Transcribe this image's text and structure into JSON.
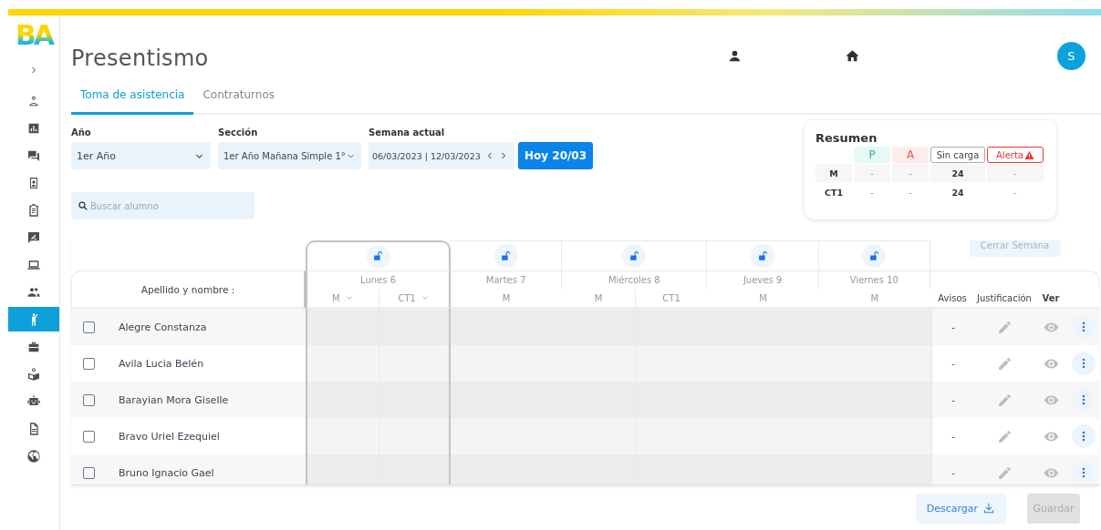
{
  "logo": {
    "text": "BA"
  },
  "sidebar": {
    "items": [
      {
        "selected": false
      },
      {
        "selected": false
      },
      {
        "selected": false
      },
      {
        "selected": false
      },
      {
        "selected": false
      },
      {
        "selected": false
      },
      {
        "selected": false
      },
      {
        "selected": false
      },
      {
        "selected": true
      },
      {
        "selected": false
      },
      {
        "selected": false
      },
      {
        "selected": false
      },
      {
        "selected": false
      },
      {
        "selected": false
      }
    ]
  },
  "header": {
    "title": "Presentismo",
    "avatar": "S"
  },
  "tabs": [
    {
      "label": "Toma de asistencia",
      "selected": true
    },
    {
      "label": "Contraturnos",
      "selected": false
    }
  ],
  "filters": [
    {
      "label": "Año",
      "value": "1er Año",
      "kind": "select"
    },
    {
      "label": "Sección",
      "value": "1er Año Mañana Simple 1°",
      "kind": "select"
    },
    {
      "label": "Semana actual",
      "value": "06/03/2023 | 12/03/2023",
      "kind": "week"
    }
  ],
  "today_button": "Hoy 20/03",
  "search": {
    "placeholder": "Buscar alumno"
  },
  "summary": {
    "title": "Resumen",
    "columns": [
      {
        "label": "P",
        "kind": "present"
      },
      {
        "label": "A",
        "kind": "absent"
      },
      {
        "label": "Sin carga",
        "kind": "empty"
      },
      {
        "label": "Alerta",
        "kind": "alert"
      }
    ],
    "rows": [
      {
        "label": "M",
        "values": [
          "-",
          "-",
          "24",
          "-"
        ]
      },
      {
        "label": "CT1",
        "values": [
          "-",
          "-",
          "24",
          "-"
        ]
      }
    ]
  },
  "close_week_button": {
    "label": "Cerrar Semana",
    "disabled": true
  },
  "table": {
    "name_header": "Apellido y nombre :",
    "days": [
      {
        "label": "Lunes 6",
        "locked": false,
        "selected": true,
        "shifts": [
          {
            "label": "M",
            "dropdown": true
          },
          {
            "label": "CT1",
            "dropdown": true
          }
        ]
      },
      {
        "label": "Martes 7",
        "locked": false,
        "selected": false,
        "shifts": [
          {
            "label": "M",
            "dropdown": false
          }
        ]
      },
      {
        "label": "Miércoles 8",
        "locked": false,
        "selected": false,
        "shifts": [
          {
            "label": "M",
            "dropdown": false
          },
          {
            "label": "CT1",
            "dropdown": false
          }
        ]
      },
      {
        "label": "Jueves 9",
        "locked": false,
        "selected": false,
        "shifts": [
          {
            "label": "M",
            "dropdown": false
          }
        ]
      },
      {
        "label": "Viernes 10",
        "locked": false,
        "selected": false,
        "shifts": [
          {
            "label": "M",
            "dropdown": false
          }
        ]
      }
    ],
    "extra_headers": [
      "Avisos",
      "Justificación",
      "Ver"
    ],
    "rows": [
      {
        "name": "Alegre Constanza",
        "checked": false,
        "avisos": "-"
      },
      {
        "name": "Avila Lucia Belén",
        "checked": false,
        "avisos": "-"
      },
      {
        "name": "Barayian Mora Giselle",
        "checked": false,
        "avisos": "-"
      },
      {
        "name": "Bravo Uriel Ezequiel",
        "checked": false,
        "avisos": "-"
      },
      {
        "name": "Bruno Ignacio Gael",
        "checked": false,
        "avisos": "-"
      }
    ]
  },
  "footer": {
    "download_button": "Descargar",
    "save_button": {
      "label": "Guardar",
      "disabled": true
    }
  }
}
